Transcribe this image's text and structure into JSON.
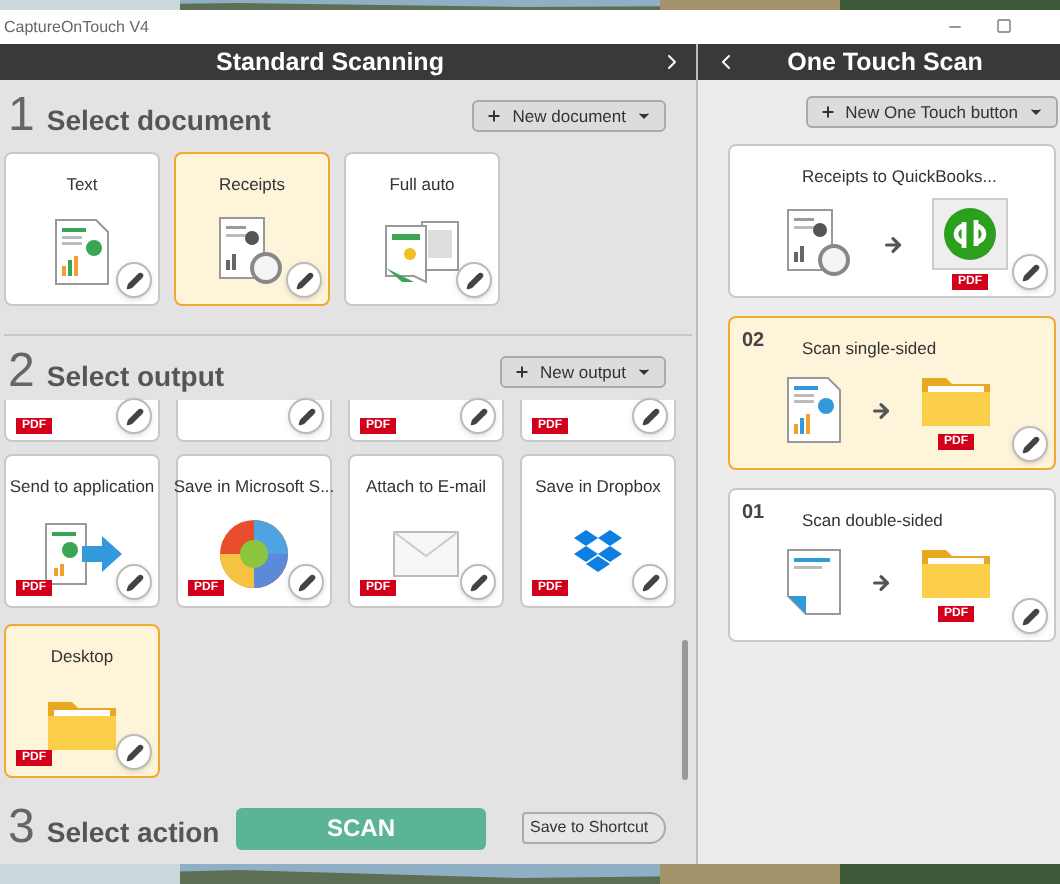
{
  "window": {
    "title": "CaptureOnTouch V4"
  },
  "standard": {
    "title": "Standard Scanning"
  },
  "document": {
    "number": "1",
    "title": "Select document",
    "button": "New document",
    "cards": [
      {
        "label": "Text",
        "kind": "text",
        "selected": false
      },
      {
        "label": "Receipts",
        "kind": "receipt",
        "selected": true
      },
      {
        "label": "Full auto",
        "kind": "auto",
        "selected": false
      }
    ]
  },
  "output": {
    "number": "2",
    "title": "Select output",
    "button": "New output",
    "partial_cards": [
      {
        "kind": "output",
        "badge": "PDF"
      },
      {
        "kind": "output"
      },
      {
        "kind": "output",
        "badge": "PDF"
      },
      {
        "kind": "output",
        "badge": "PDF"
      }
    ],
    "cards": [
      {
        "label": "Send to application",
        "kind": "app",
        "badge": "PDF",
        "selected": false
      },
      {
        "label": "Save in Microsoft S...",
        "kind": "sharepoint",
        "badge": "PDF",
        "selected": false
      },
      {
        "label": "Attach to E-mail",
        "kind": "mail",
        "badge": "PDF",
        "selected": false
      },
      {
        "label": "Save in Dropbox",
        "kind": "dropbox",
        "badge": "PDF",
        "selected": false
      },
      {
        "label": "Desktop",
        "kind": "folder",
        "badge": "PDF",
        "selected": true
      }
    ]
  },
  "action": {
    "number": "3",
    "title": "Select action",
    "scan": "SCAN",
    "shortcut": "Save to Shortcut"
  },
  "one_touch": {
    "title": "One Touch Scan",
    "button": "New One Touch button",
    "items": [
      {
        "label": "Receipts to QuickBooks...",
        "kind": "quickbooks",
        "badge": "PDF",
        "selected": false
      },
      {
        "number": "02",
        "label": "Scan single-sided",
        "kind": "single",
        "badge": "PDF",
        "selected": true
      },
      {
        "number": "01",
        "label": "Scan double-sided",
        "kind": "double",
        "badge": "PDF",
        "selected": false
      }
    ]
  }
}
